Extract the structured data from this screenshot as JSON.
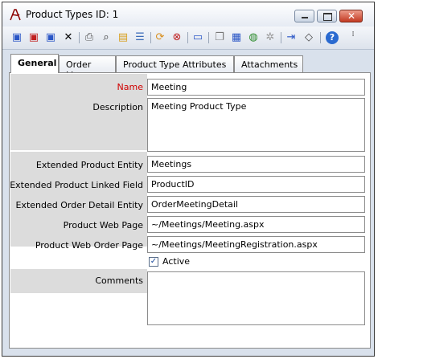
{
  "window": {
    "title": "Product Types ID: 1"
  },
  "tabs": [
    {
      "label": "General"
    },
    {
      "label": "Order Line"
    },
    {
      "label": "Product Type Attributes"
    },
    {
      "label": "Attachments"
    }
  ],
  "form": {
    "name": {
      "label": "Name",
      "value": "Meeting"
    },
    "description": {
      "label": "Description",
      "value": "Meeting Product Type"
    },
    "extended_entity": {
      "label": "Extended Product Entity",
      "value": "Meetings"
    },
    "linked_field": {
      "label": "Extended Product Linked Field",
      "value": "ProductID"
    },
    "order_detail_entity": {
      "label": "Extended Order Detail Entity",
      "value": "OrderMeetingDetail"
    },
    "web_page": {
      "label": "Product Web Page",
      "value": "~/Meetings/Meeting.aspx"
    },
    "web_order_page": {
      "label": "Product Web Order Page",
      "value": "~/Meetings/MeetingRegistration.aspx"
    },
    "active": {
      "label": "Active",
      "checked": true
    },
    "comments": {
      "label": "Comments",
      "value": ""
    }
  },
  "toolbar_icons": [
    "save-icon",
    "save-new-icon",
    "save-close-icon",
    "delete-icon",
    "print-icon",
    "find-icon",
    "new-folder-icon",
    "list-icon",
    "refresh-icon",
    "remove-icon",
    "tag-icon",
    "copy-icon",
    "paste-icon",
    "globe-icon",
    "settings-icon",
    "login-icon",
    "eraser-icon",
    "help-icon",
    "more-icon"
  ],
  "colors": {
    "required_label": "#d00000",
    "label_background": "#dcdcdc",
    "window_background": "#d9e1ec"
  }
}
